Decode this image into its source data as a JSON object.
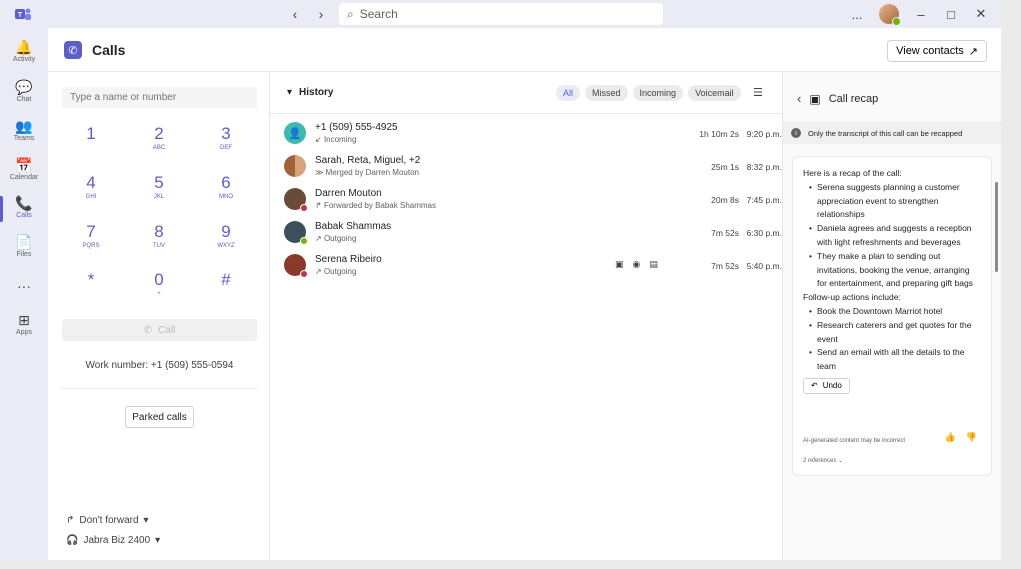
{
  "titlebar": {
    "back_icon": "back-arrow-icon",
    "forward_icon": "forward-arrow-icon",
    "search_placeholder": "Search",
    "more_label": "...",
    "minimize_label": "–",
    "maximize_label": "□",
    "close_label": "✕"
  },
  "rail": {
    "items": [
      {
        "label": "Activity",
        "icon": "bell-icon",
        "glyph": "🔔"
      },
      {
        "label": "Chat",
        "icon": "chat-icon",
        "glyph": "💬"
      },
      {
        "label": "Teams",
        "icon": "teams-icon",
        "glyph": "👥"
      },
      {
        "label": "Calendar",
        "icon": "calendar-icon",
        "glyph": "📅"
      },
      {
        "label": "Calls",
        "icon": "phone-icon",
        "glyph": "📞"
      },
      {
        "label": "Files",
        "icon": "file-icon",
        "glyph": "📄"
      },
      {
        "label": "",
        "icon": "more-icon",
        "glyph": "···"
      },
      {
        "label": "Apps",
        "icon": "apps-icon",
        "glyph": "⊞"
      }
    ]
  },
  "header": {
    "title": "Calls",
    "view_contacts": "View contacts"
  },
  "dialer": {
    "input_placeholder": "Type a name or number",
    "keys": [
      {
        "digit": "1",
        "letters": ""
      },
      {
        "digit": "2",
        "letters": "ABC"
      },
      {
        "digit": "3",
        "letters": "DEF"
      },
      {
        "digit": "4",
        "letters": "GHI"
      },
      {
        "digit": "5",
        "letters": "JKL"
      },
      {
        "digit": "6",
        "letters": "MNO"
      },
      {
        "digit": "7",
        "letters": "PQRS"
      },
      {
        "digit": "8",
        "letters": "TUV"
      },
      {
        "digit": "9",
        "letters": "WXYZ"
      },
      {
        "digit": "*",
        "letters": ""
      },
      {
        "digit": "0",
        "letters": "+"
      },
      {
        "digit": "#",
        "letters": ""
      }
    ],
    "call_label": "Call",
    "work_number": "Work number: +1 (509) 555-0594",
    "parked_calls": "Parked calls",
    "forward_label": "Don't forward",
    "device_label": "Jabra Biz 2400"
  },
  "history": {
    "title": "History",
    "filters": [
      "All",
      "Missed",
      "Incoming",
      "Voicemail"
    ],
    "active_filter": "All",
    "rows": [
      {
        "name": "+1 (509) 555-4925",
        "sub": "Incoming",
        "duration": "1h 10m 2s",
        "time": "9:20 p.m.",
        "avatar_color": "#3fb8af",
        "status": ""
      },
      {
        "name": "Sarah, Reta, Miguel, +2",
        "sub": "Merged by Darren Mouton",
        "duration": "25m 1s",
        "time": "8:32 p.m.",
        "avatar_color": "#a0643c",
        "status": ""
      },
      {
        "name": "Darren Mouton",
        "sub": "Forwarded by Babak Shammas",
        "duration": "20m 8s",
        "time": "7:45 p.m.",
        "avatar_color": "#6b4a3a",
        "status": "#c4314b"
      },
      {
        "name": "Babak Shammas",
        "sub": "Outgoing",
        "duration": "7m 52s",
        "time": "6:30 p.m.",
        "avatar_color": "#3d4f5c",
        "status": "#6bb700"
      },
      {
        "name": "Serena Ribeiro",
        "sub": "Outgoing",
        "duration": "7m 52s",
        "time": "5:40 p.m.",
        "avatar_color": "#8a3a2a",
        "status": "#c4314b"
      }
    ]
  },
  "recap": {
    "title": "Call recap",
    "info": "Only the transcript of this call can be recapped",
    "intro": "Here is a recap of the call:",
    "points": [
      "Serena suggests planning a customer appreciation event to strengthen relationships",
      "Daniela agrees and suggests a reception with light refreshments and beverages",
      "They make a plan to sending out invitations, booking the venue, arranging for entertainment, and preparing gift bags"
    ],
    "followup_title": "Follow-up actions include:",
    "followups": [
      "Book the Downtown Marriot hotel",
      "Research caterers and get quotes for the event",
      "Send an email with all the details to the team"
    ],
    "undo": "Undo",
    "ai_note": "AI-generated content may be incorrect",
    "references": "2 references"
  },
  "colors": {
    "accent": "#5b5fc7",
    "online": "#6bb700",
    "busy": "#c4314b"
  }
}
